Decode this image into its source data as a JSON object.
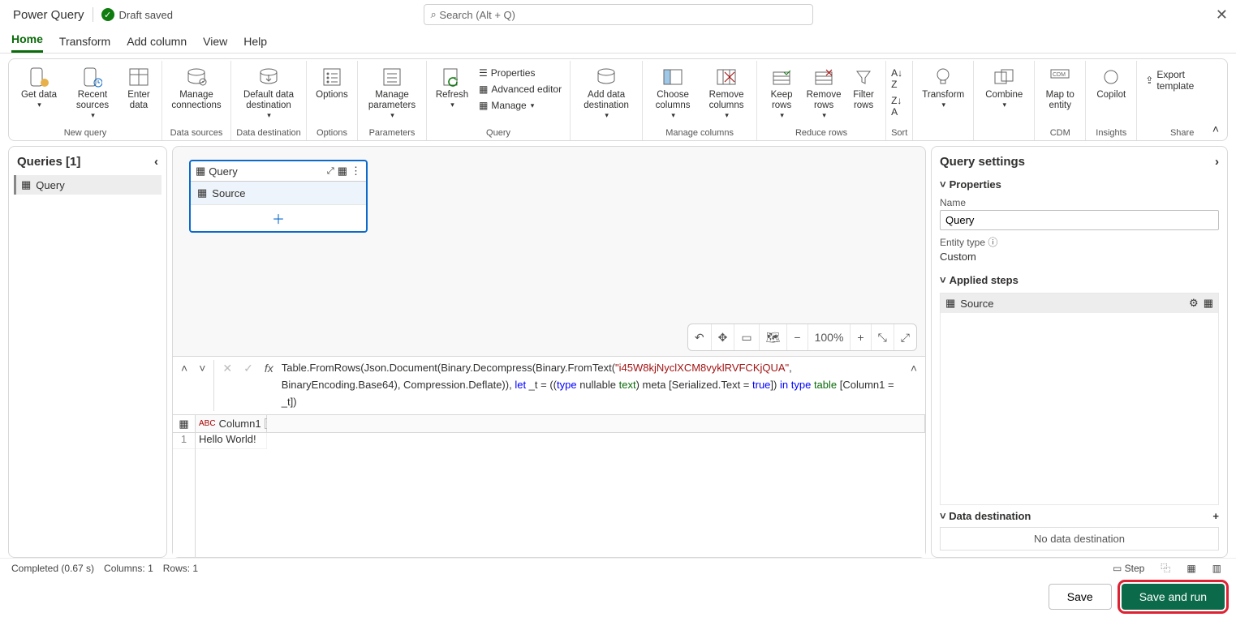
{
  "titlebar": {
    "title": "Power Query",
    "status": "Draft saved",
    "search_placeholder": "Search (Alt + Q)"
  },
  "tabs": [
    "Home",
    "Transform",
    "Add column",
    "View",
    "Help"
  ],
  "ribbon": {
    "new_query": {
      "get_data": "Get\ndata",
      "recent_sources": "Recent\nsources",
      "enter_data": "Enter\ndata",
      "label": "New query"
    },
    "data_sources": {
      "manage_connections": "Manage\nconnections",
      "label": "Data sources"
    },
    "data_destination": {
      "default": "Default data\ndestination",
      "label": "Data destination"
    },
    "options": {
      "options": "Options",
      "label": "Options"
    },
    "parameters": {
      "manage": "Manage\nparameters",
      "label": "Parameters"
    },
    "query": {
      "refresh": "Refresh",
      "properties": "Properties",
      "advanced": "Advanced editor",
      "manage": "Manage",
      "label": "Query"
    },
    "add_data": {
      "add": "Add data\ndestination",
      "label": ""
    },
    "manage_cols": {
      "choose": "Choose\ncolumns",
      "remove": "Remove\ncolumns",
      "label": "Manage columns"
    },
    "reduce_rows": {
      "keep": "Keep\nrows",
      "remove": "Remove\nrows",
      "filter": "Filter\nrows",
      "label": "Reduce rows"
    },
    "sort": {
      "label": "Sort"
    },
    "transform": {
      "btn": "Transform",
      "label": ""
    },
    "combine": {
      "btn": "Combine",
      "label": ""
    },
    "cdm": {
      "btn": "Map to\nentity",
      "label": "CDM"
    },
    "insights": {
      "btn": "Copilot",
      "label": "Insights"
    },
    "share": {
      "btn": "Export template",
      "label": "Share"
    }
  },
  "queries_pane": {
    "title": "Queries [1]",
    "item": "Query"
  },
  "query_box": {
    "title": "Query",
    "step": "Source"
  },
  "zoom": "100%",
  "formula": {
    "p1": "Table.FromRows(Json.Document(Binary.Decompress(Binary.FromText(",
    "s1": "\"i45W8kjNyclXCM8vyklRVFCKjQUA\"",
    "p2": ", BinaryEncoding.Base64), Compression.Deflate)), ",
    "kw_let": "let",
    "p3": " _t = ((",
    "kw_type1": "type",
    "p4": " nullable ",
    "ty_text": "text",
    "p5": ") meta [Serialized.Text = ",
    "kw_true": "true",
    "p6": "]) ",
    "kw_in": "in",
    "p7": " ",
    "kw_type2": "type",
    "p8": " ",
    "ty_table": "table",
    "p9": " [Column1 = _t])"
  },
  "grid": {
    "col1": "Column1",
    "row1": "1",
    "cell1": "Hello World!"
  },
  "settings": {
    "title": "Query settings",
    "properties": "Properties",
    "name_label": "Name",
    "name_value": "Query",
    "entity_type_label": "Entity type",
    "entity_type_value": "Custom",
    "applied_steps": "Applied steps",
    "step": "Source",
    "data_destination": "Data destination",
    "no_dest": "No data destination"
  },
  "statusbar": {
    "completed": "Completed (0.67 s)",
    "cols": "Columns: 1",
    "rows": "Rows: 1",
    "step_btn": "Step"
  },
  "footer": {
    "save": "Save",
    "save_run": "Save and run"
  }
}
